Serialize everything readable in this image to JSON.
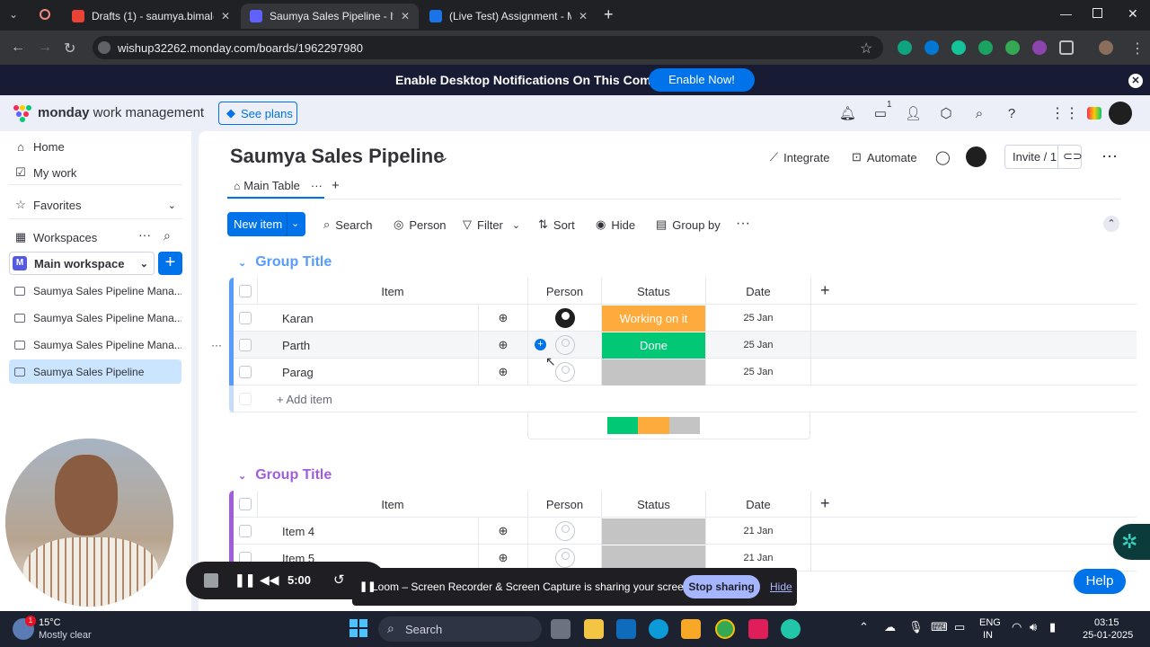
{
  "browser": {
    "tabs": [
      {
        "title": "Drafts (1) - saumya.bimal@wis",
        "active": false
      },
      {
        "title": "Saumya Sales Pipeline - Item",
        "active": true
      },
      {
        "title": "(Live Test) Assignment - Monda",
        "active": false
      }
    ],
    "url": "wishup32262.monday.com/boards/1962297980"
  },
  "banner": {
    "text": "Enable Desktop Notifications On This Computer",
    "button": "Enable Now!"
  },
  "topbar": {
    "brand_bold": "monday",
    "brand_rest": " work management",
    "see_plans": "See plans",
    "inbox_badge": "1"
  },
  "sidebar": {
    "home": "Home",
    "my_work": "My work",
    "favorites": "Favorites",
    "workspaces": "Workspaces",
    "workspace_name": "Main workspace",
    "workspace_badge": "M",
    "boards": [
      "Saumya Sales Pipeline Mana...",
      "Saumya Sales Pipeline Mana...",
      "Saumya Sales Pipeline Mana...",
      "Saumya Sales Pipeline"
    ]
  },
  "board": {
    "title": "Saumya Sales Pipeline",
    "integrate": "Integrate",
    "automate": "Automate",
    "invite": "Invite / 1",
    "view_tab": "Main Table",
    "toolbar": {
      "new_item": "New item",
      "search": "Search",
      "person": "Person",
      "filter": "Filter",
      "sort": "Sort",
      "hide": "Hide",
      "group_by": "Group by"
    },
    "columns": {
      "item": "Item",
      "person": "Person",
      "status": "Status",
      "date": "Date"
    },
    "add_item": "+ Add item",
    "groups": [
      {
        "title": "Group Title",
        "color": "#579bfc",
        "rows": [
          {
            "name": "Karan",
            "status": "Working on it",
            "status_color": "#fdab3d",
            "date": "25 Jan"
          },
          {
            "name": "Parth",
            "status": "Done",
            "status_color": "#00c875",
            "date": "25 Jan"
          },
          {
            "name": "Parag",
            "status": "",
            "status_color": "#c4c4c4",
            "date": "25 Jan"
          }
        ]
      },
      {
        "title": "Group Title",
        "color": "#a25ddc",
        "rows": [
          {
            "name": "Item 4",
            "status": "",
            "status_color": "#c4c4c4",
            "date": "21 Jan"
          },
          {
            "name": "Item 5",
            "status": "",
            "status_color": "#c4c4c4",
            "date": "21 Jan"
          }
        ]
      }
    ]
  },
  "loom": {
    "timer": "5:00",
    "message": "Loom – Screen Recorder & Screen Capture is sharing your screen and audio.",
    "stop": "Stop sharing",
    "hide": "Hide"
  },
  "help": "Help",
  "taskbar": {
    "temp": "15°C",
    "weather": "Mostly clear",
    "search": "Search",
    "lang1": "ENG",
    "lang2": "IN",
    "time": "03:15",
    "date": "25-01-2025"
  }
}
